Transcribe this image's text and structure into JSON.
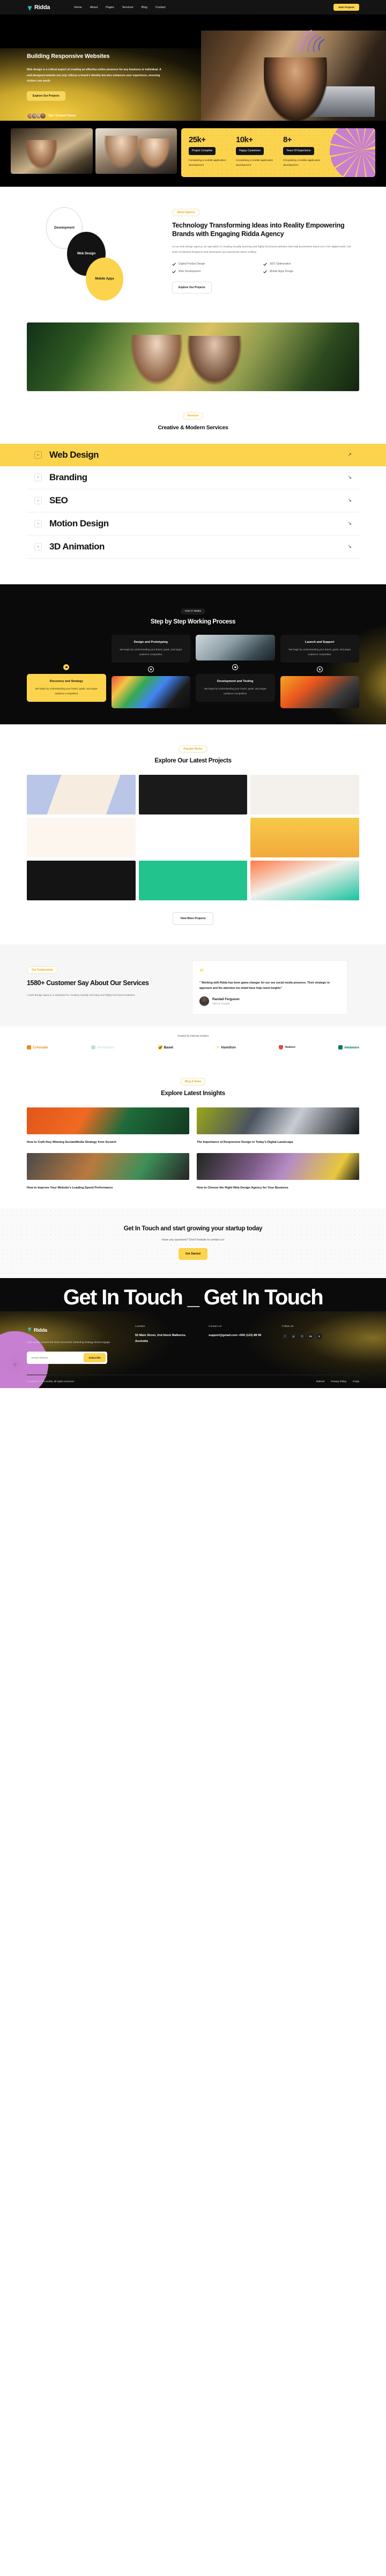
{
  "header": {
    "brand": "Ridda",
    "nav": [
      "Home",
      "About",
      "Pages",
      "Services",
      "Blog",
      "Contact"
    ],
    "cta": "Start Projects"
  },
  "hero": {
    "title": "Building Responsive Websites",
    "paragraph": "Web design is a critical aspect of creating an effective online presence for any business or individual. A well-designed website not only reflects a brand's identity but also enhances user experience, ensuring visitors can easily",
    "cta": "Explore Our Projects",
    "clients": "5m+ Trusted Clients"
  },
  "stats": [
    {
      "number": "25k+",
      "chip": "Project Complete",
      "desc": "Completing a mobile application development"
    },
    {
      "number": "10k+",
      "chip": "Happy Customers",
      "desc": "Completing a mobile application development"
    },
    {
      "number": "8+",
      "chip": "Years Of Experience",
      "desc": "Completing a mobile application development"
    }
  ],
  "about": {
    "pill": "About Agency",
    "heading": "Technology Transforming Ideas into Reality Empowering Brands with Engaging Ridda Agency",
    "paragraph": "At our web design agency, we specialize in creating visually stunning and highly functional websites that help businesses stand out in the digital world. Our team of talented designers and developers are passionate about crafting",
    "checks": [
      "Digital Product Design",
      "SEO Optimization",
      "Web Development",
      "Mobile Apps Design"
    ],
    "cta": "Explore Our Projects",
    "bubbles": [
      "Development",
      "Web Design",
      "Mobile Apps"
    ]
  },
  "services": {
    "pill": "Services",
    "heading": "Creative & Modern Services",
    "items": [
      {
        "num": "01",
        "name": "Web Design",
        "arrow": "↗",
        "active": true
      },
      {
        "num": "02",
        "name": "Branding",
        "arrow": "↘",
        "active": false
      },
      {
        "num": "03",
        "name": "SEO",
        "arrow": "↘",
        "active": false
      },
      {
        "num": "04",
        "name": "Motion Design",
        "arrow": "↘",
        "active": false
      },
      {
        "num": "05",
        "name": "3D Animation",
        "arrow": "↘",
        "active": false
      }
    ]
  },
  "process": {
    "pill": "How IT Works",
    "heading": "Step by Step Working Process",
    "steps": [
      {
        "title": "Discovery and Strategy",
        "desc": "We begin by understanding your brand, goals, and target audience competitive"
      },
      {
        "title": "Design and Prototyping",
        "desc": "We begin by understanding your brand, goals, and target audience competitive"
      },
      {
        "title": "Development and Testing",
        "desc": "We begin by understanding your brand, goals, and target audience competitive"
      },
      {
        "title": "Launch and Support",
        "desc": "We begin by understanding your brand, goals, and target audience competitive"
      }
    ]
  },
  "projects": {
    "pill": "Popular Works",
    "heading": "Explore Our Latest Projects",
    "cta": "View More Projects"
  },
  "testimonials": {
    "pill": "Out Testimonials",
    "heading": "1580+ Customer Say About Our Services",
    "paragraph": "A web design agency is dedicated to creating visually stunning and highly functional websites.",
    "quote": "” Working with Ridda has been game-changer for our see social media presence. Their strategic to approach and the attention too detail have help reach heights”",
    "author": "Randall Ferguson",
    "role": "CEO & Founder"
  },
  "logos": {
    "title": "Trusted by industry leaders",
    "brands": [
      "Colorado",
      "Amsterdam",
      "Basel",
      "Hamilton",
      "Hudson",
      "delaware"
    ]
  },
  "blog": {
    "pill": "Blog & News",
    "heading": "Explore Latest Insights",
    "posts": [
      {
        "title": "How to Craft they Winning SocialsMedia Strategy from Scratch"
      },
      {
        "title": "The Importance of Responsive Design in Today's Digital Landscape"
      },
      {
        "title": "How to Improve Your Website's Loading Speed Performance"
      },
      {
        "title": "How to Choose the Right Web Design Agency for Your Business"
      }
    ]
  },
  "cta": {
    "heading": "Get In Touch and start growing your startup today",
    "paragraph": "Have any questions? Don't hesitate to contact us!",
    "button": "Get Started"
  },
  "marquee": {
    "text": "Get In Touch _ Get In Touch"
  },
  "footer": {
    "brand": "Ridda",
    "desc": "High-quality content the heart successful marketing strategy drives engage.",
    "email_placeholder": "Email Address",
    "subscribe": "Subscribe",
    "location_title": "Location",
    "location_value": "55 Main Street, 2nd block Malborne, Australia",
    "contact_title": "Contact Us",
    "contact_value": "support@gmail.com +000 (123) 88 99",
    "follow_title": "Follow Us",
    "social": [
      "f",
      "◎",
      "Ⓢ",
      "Be",
      "in"
    ],
    "copyright": "Copyright ©Themesflat, all rights reserved.",
    "links": [
      "Refund",
      "Privacy Policy",
      "FAQs"
    ]
  },
  "colors": {
    "accent": "#FBD34D",
    "dark": "#0B0B0B",
    "muted": "#6C6C6C"
  }
}
